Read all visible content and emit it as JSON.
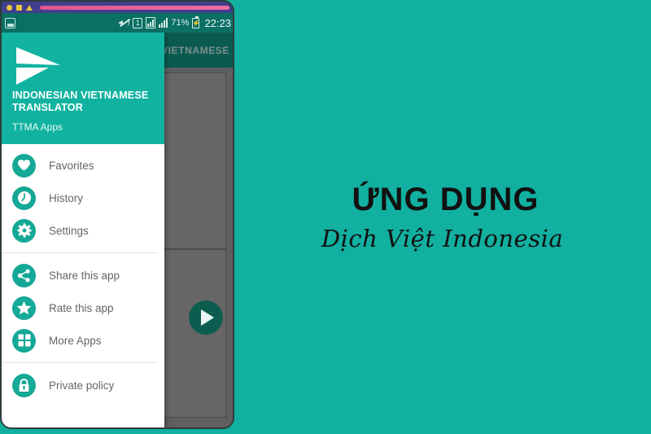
{
  "window": {
    "controls": [
      "circle",
      "square",
      "triangle"
    ],
    "progress_bar": true,
    "accent": "#e1558f",
    "bar_color": "#403f8e"
  },
  "statusbar": {
    "screenshot_icon": "image-icon",
    "mute_icon": "volume-mute-icon",
    "sim_badge": "1",
    "signal_icon_1": "signal-boxed-icon",
    "signal_icon_2": "signal-icon",
    "battery_percent": "71%",
    "battery_icon": "battery-charging-icon",
    "clock": "22:23",
    "background": "#0b6f63"
  },
  "app": {
    "toolbar_title": "VIETNAMESE",
    "fab_icon": "play-triangle-icon",
    "accent": "#0d5c50",
    "scrim_background": "#5f5f5f"
  },
  "drawer": {
    "header": {
      "logo_icon": "paper-plane-icon",
      "title": "INDONESIAN VIETNAMESE TRANSLATOR",
      "subtitle": "TTMA Apps",
      "background": "#11b3a0"
    },
    "groups": [
      {
        "items": [
          {
            "label": "Favorites",
            "icon": "heart-icon"
          },
          {
            "label": "History",
            "icon": "clock-icon"
          },
          {
            "label": "Settings",
            "icon": "gear-icon"
          }
        ]
      },
      {
        "items": [
          {
            "label": "Share this app",
            "icon": "share-icon"
          },
          {
            "label": "Rate this app",
            "icon": "star-icon"
          },
          {
            "label": "More Apps",
            "icon": "grid-apps-icon"
          }
        ]
      },
      {
        "items": [
          {
            "label": "Private policy",
            "icon": "lock-icon"
          }
        ]
      }
    ],
    "icon_color": "#14a896"
  },
  "promo": {
    "title": "ỨNG DỤNG",
    "subtitle": "Dịch Việt Indonesia",
    "background": "#11b0a0",
    "text_color": "#111111"
  }
}
